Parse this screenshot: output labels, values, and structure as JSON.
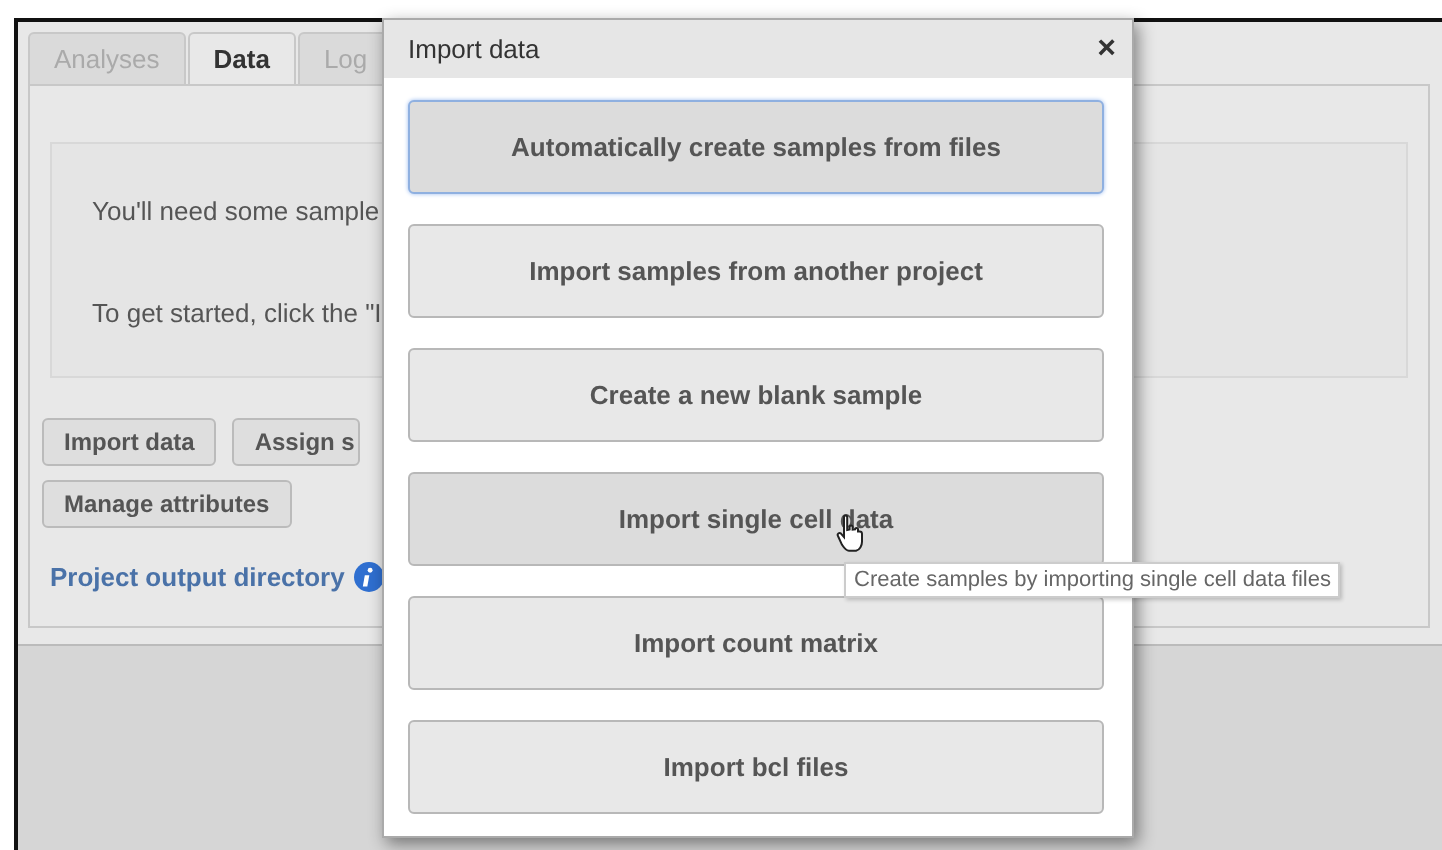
{
  "tabs": [
    {
      "label": "Analyses",
      "selected": false,
      "disabled": true
    },
    {
      "label": "Data",
      "selected": true,
      "disabled": false
    },
    {
      "label": "Log",
      "selected": false,
      "disabled": true
    }
  ],
  "message": [
    "You'll need some sample",
    "To get started, click the \"I"
  ],
  "actions": [
    [
      "Import data",
      "Assign s"
    ],
    [
      "Manage attributes"
    ]
  ],
  "output_link": "Project output directory",
  "dialog": {
    "title": "Import data",
    "close": "×",
    "options": [
      {
        "label": "Automatically create samples from files",
        "focused": true,
        "hovered": false
      },
      {
        "label": "Import samples from another project",
        "focused": false,
        "hovered": false
      },
      {
        "label": "Create a new blank sample",
        "focused": false,
        "hovered": false
      },
      {
        "label": "Import single cell data",
        "focused": false,
        "hovered": true
      },
      {
        "label": "Import count matrix",
        "focused": false,
        "hovered": false
      },
      {
        "label": "Import bcl files",
        "focused": false,
        "hovered": false
      }
    ]
  },
  "tooltip": "Create samples by importing single cell data files"
}
